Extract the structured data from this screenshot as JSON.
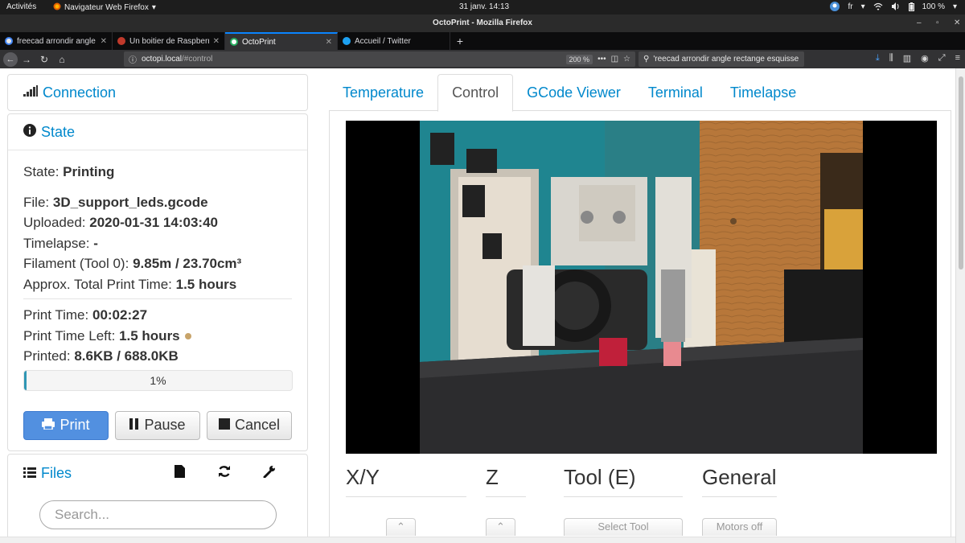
{
  "system_bar": {
    "activities": "Activités",
    "app_menu": "Navigateur Web Firefox",
    "clock": "31 janv.  14:13",
    "lang": "fr",
    "battery": "100 %"
  },
  "window": {
    "title": "OctoPrint - Mozilla Firefox"
  },
  "browser_tabs": [
    {
      "label": "freecad arrondir angle re",
      "favicon_color": "#e8e8e8"
    },
    {
      "label": "Un boitier de Raspberry",
      "favicon_color": "#c0392b"
    },
    {
      "label": "OctoPrint",
      "favicon_color": "#27ae60",
      "active": true
    },
    {
      "label": "Accueil / Twitter",
      "favicon_color": "#1da1f2"
    }
  ],
  "urlbar": {
    "url_host": "octopi.local",
    "url_path": "/#control",
    "zoom": "200 %",
    "search_text": "'reecad arrondir angle rectange esquisse"
  },
  "sidebar": {
    "connection": {
      "title": "Connection"
    },
    "state": {
      "title": "State",
      "state_label": "State:",
      "state_value": "Printing",
      "file_label": "File:",
      "file_value": "3D_support_leds.gcode",
      "uploaded_label": "Uploaded:",
      "uploaded_value": "2020-01-31 14:03:40",
      "timelapse_label": "Timelapse:",
      "timelapse_value": "-",
      "filament_label": "Filament (Tool 0):",
      "filament_value": "9.85m / 23.70cm³",
      "approx_label": "Approx. Total Print Time:",
      "approx_value": "1.5 hours",
      "print_time_label": "Print Time:",
      "print_time_value": "00:02:27",
      "time_left_label": "Print Time Left:",
      "time_left_value": "1.5 hours",
      "printed_label": "Printed:",
      "printed_value": "8.6KB / 688.0KB",
      "progress_text": "1%",
      "progress_value": 0.01,
      "buttons": {
        "print": "Print",
        "pause": "Pause",
        "cancel": "Cancel"
      }
    },
    "files": {
      "title": "Files",
      "search_placeholder": "Search..."
    }
  },
  "main_tabs": [
    {
      "label": "Temperature"
    },
    {
      "label": "Control",
      "active": true
    },
    {
      "label": "GCode Viewer"
    },
    {
      "label": "Terminal"
    },
    {
      "label": "Timelapse"
    }
  ],
  "control": {
    "xy_title": "X/Y",
    "z_title": "Z",
    "tool_title": "Tool (E)",
    "general_title": "General",
    "select_tool": "Select Tool",
    "motors_off": "Motors off"
  },
  "colors": {
    "link": "#0088cc",
    "primary_button": "#5290e0",
    "progress_fill": "#2f96b4",
    "browser_dark": "#0c0c0d"
  }
}
